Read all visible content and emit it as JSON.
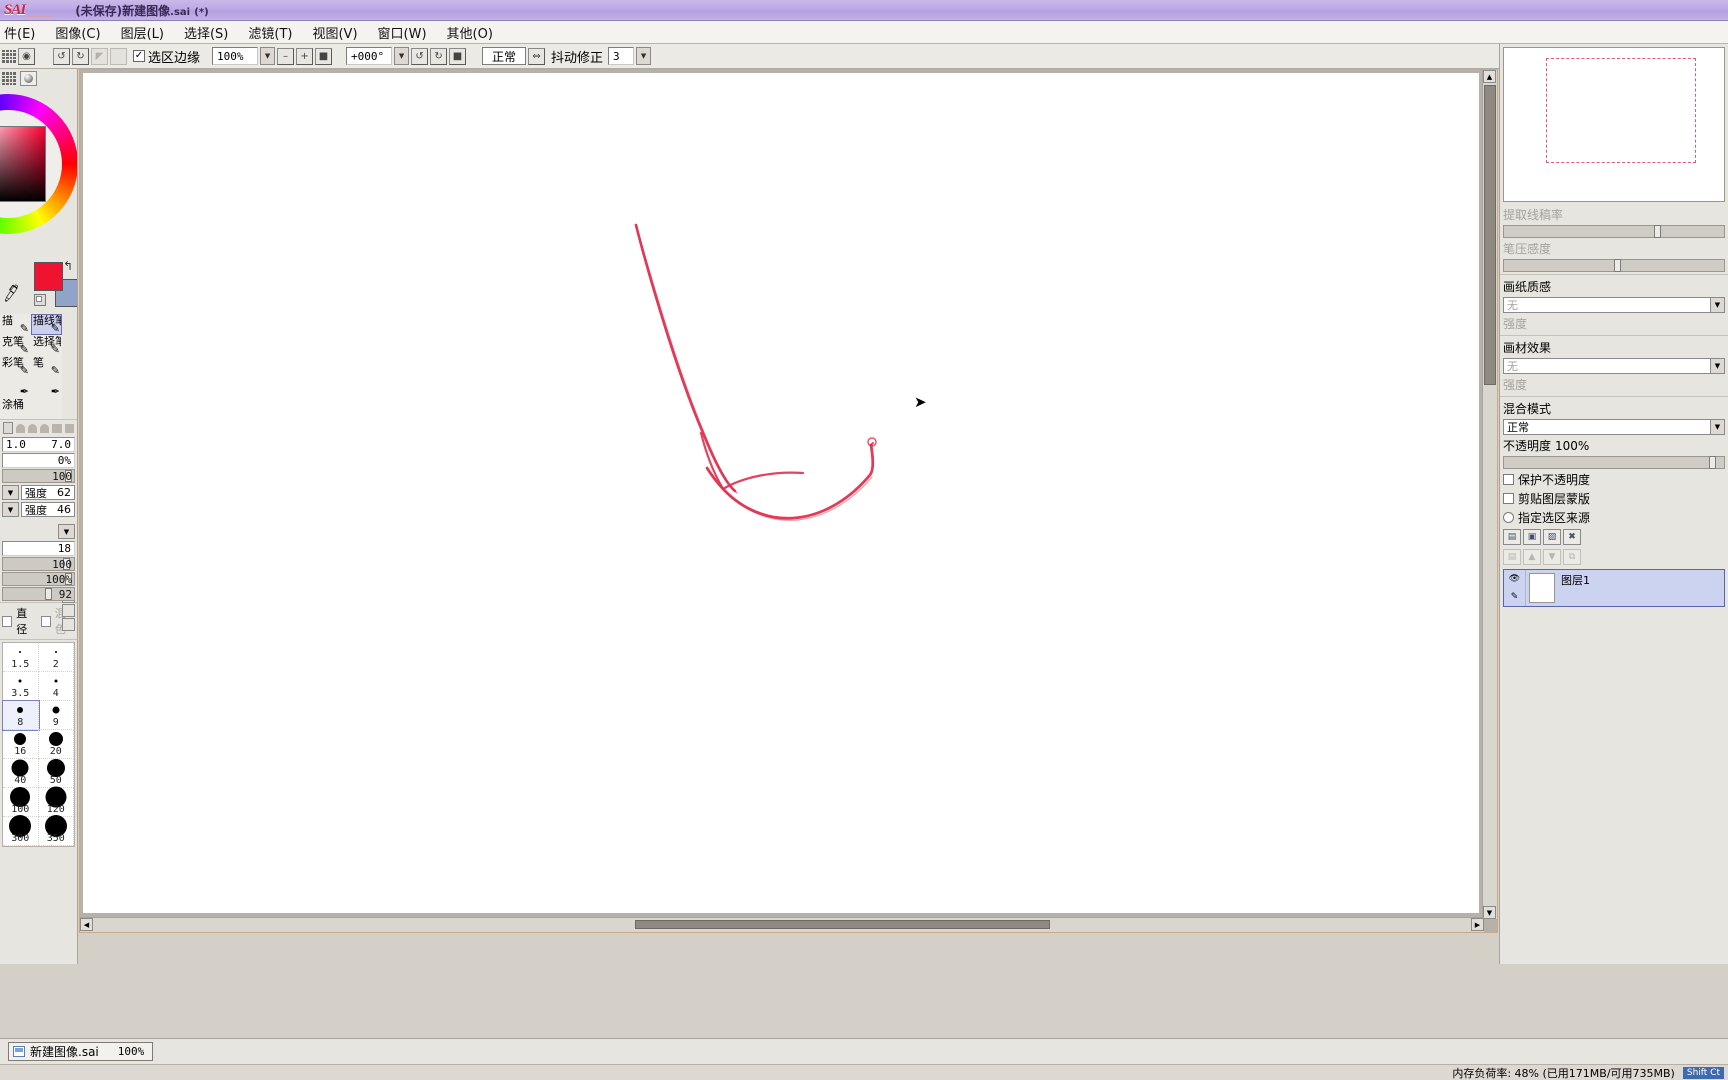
{
  "app": {
    "logo": "SAI",
    "title": "(未保存)新建图像",
    "title_ext": ".sai",
    "title_modified": "(*)"
  },
  "menubar": {
    "items": [
      {
        "label": "件(E)",
        "name": "menu-file"
      },
      {
        "label": "图像(C)",
        "name": "menu-image"
      },
      {
        "label": "图层(L)",
        "name": "menu-layer"
      },
      {
        "label": "选择(S)",
        "name": "menu-select"
      },
      {
        "label": "滤镜(T)",
        "name": "menu-filter"
      },
      {
        "label": "视图(V)",
        "name": "menu-view"
      },
      {
        "label": "窗口(W)",
        "name": "menu-window"
      },
      {
        "label": "其他(O)",
        "name": "menu-other"
      }
    ]
  },
  "toolbar": {
    "undo_icon": "↺",
    "redo_icon": "↻",
    "sel_edge_label": "选区边缘",
    "sel_edge_checked": "✓",
    "zoom_value": "100%",
    "zoom_out_icon": "–",
    "zoom_in_icon": "+",
    "zoom_reset_icon": "■",
    "rotate_value": "+000°",
    "rot_ccw_icon": "↺",
    "rot_cw_icon": "↻",
    "rot_reset_icon": "■",
    "blend_mode": "正常",
    "flip_icon": "⇔",
    "jitter_label": "抖动修正",
    "jitter_value": "3",
    "dropdown_icon": "▼"
  },
  "left_panel": {
    "swatches": {
      "primary_color": "#ef1331",
      "secondary_color": "#8fa4c8",
      "swap_icon": "↰"
    },
    "tools": [
      {
        "label": "描",
        "name": "tool-sketch",
        "selected": false
      },
      {
        "label": "描线笔",
        "name": "tool-lineart-pen",
        "selected": true
      },
      {
        "label": "克笔",
        "name": "tool-marker",
        "selected": false
      },
      {
        "label": "选择笔",
        "name": "tool-select-pen",
        "selected": false
      },
      {
        "label": "彩笔",
        "name": "tool-watercolor",
        "selected": false
      },
      {
        "label": "笔",
        "name": "tool-pen",
        "selected": false
      },
      {
        "label": "",
        "name": "tool-blank",
        "selected": false
      },
      {
        "label": "",
        "name": "tool-blank2",
        "selected": false
      },
      {
        "label": "涂桶",
        "name": "tool-bucket",
        "selected": false
      },
      {
        "label": "",
        "name": "tool-blank3",
        "selected": false
      }
    ],
    "min_size": "1.0",
    "max_size": "7.0",
    "percent_field": "0%",
    "density_value": "100",
    "strength_label_1": "强度",
    "strength_value_1": "62",
    "strength_label_2": "强度",
    "strength_value_2": "46",
    "value_18": "18",
    "value_100": "100",
    "value_100pct": "100%",
    "value_92": "92",
    "diameter_label": "直径",
    "blend_label": "混色",
    "brush_sizes": [
      "1.5",
      "2",
      "3.5",
      "4",
      "8",
      "9",
      "16",
      "20",
      "40",
      "50",
      "100",
      "120",
      "300",
      "350"
    ]
  },
  "right_panel": {
    "line_extract_label": "提取线稿率",
    "pen_pressure_label": "笔压感度",
    "paper_texture_label": "画纸质感",
    "paper_texture_value": "无",
    "paper_strength_label": "强度",
    "material_effect_label": "画材效果",
    "material_value": "无",
    "material_strength_label": "强度",
    "blend_mode_label": "混合模式",
    "blend_mode_value": "正常",
    "opacity_label": "不透明度",
    "opacity_value": "100%",
    "protect_alpha_label": "保护不透明度",
    "clipping_label": "剪贴图层蒙版",
    "select_source_label": "指定选区来源",
    "layer_name": "图层1",
    "new_layer_icon": "▤",
    "new_group_icon": "▣",
    "new_mask_icon": "▨",
    "delete_icon": "✖"
  },
  "canvas": {
    "cursor_icon": "↖",
    "stroke_color": "#e0304f"
  },
  "taskbar": {
    "doc_name": "新建图像.sai",
    "doc_zoom": "100%"
  },
  "statusbar": {
    "memory_text": "内存负荷率: 48%  (已用171MB/可用735MB)",
    "shift_badge": "Shift Ct"
  }
}
